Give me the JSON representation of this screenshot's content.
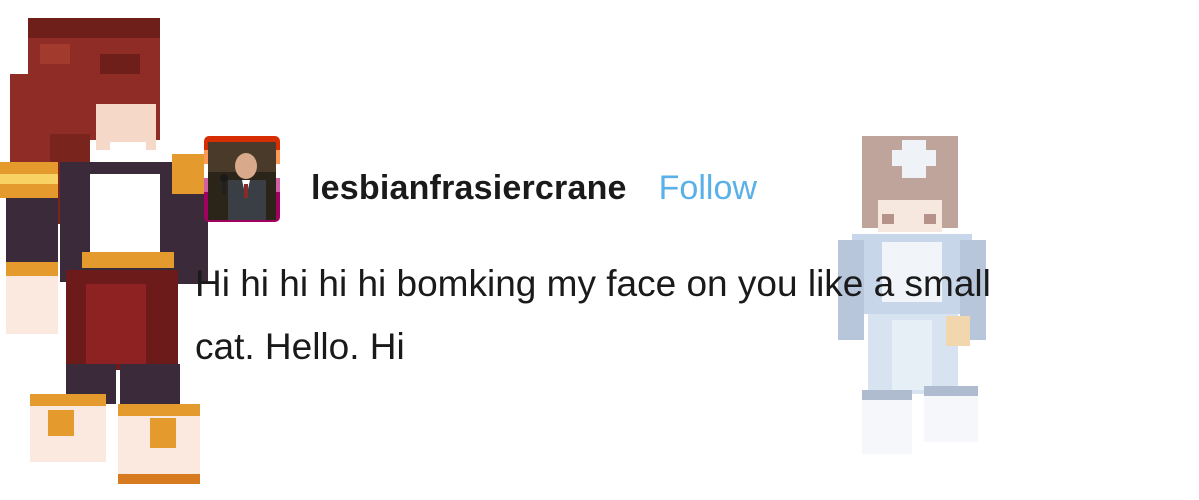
{
  "post": {
    "username": "lesbianfrasiercrane",
    "follow_label": "Follow",
    "body_line1": "Hi hi hi hi hi bomking my face on you like a small",
    "body_line2": "cat. Hello. Hi"
  },
  "colors": {
    "text": "#1a1a1a",
    "follow": "#5ab0e8",
    "background": "#ffffff"
  },
  "images": {
    "left_figure": "red-haired minecraft character",
    "right_figure": "faded blue minecraft character",
    "avatar": "profile picture of man with microphone"
  }
}
